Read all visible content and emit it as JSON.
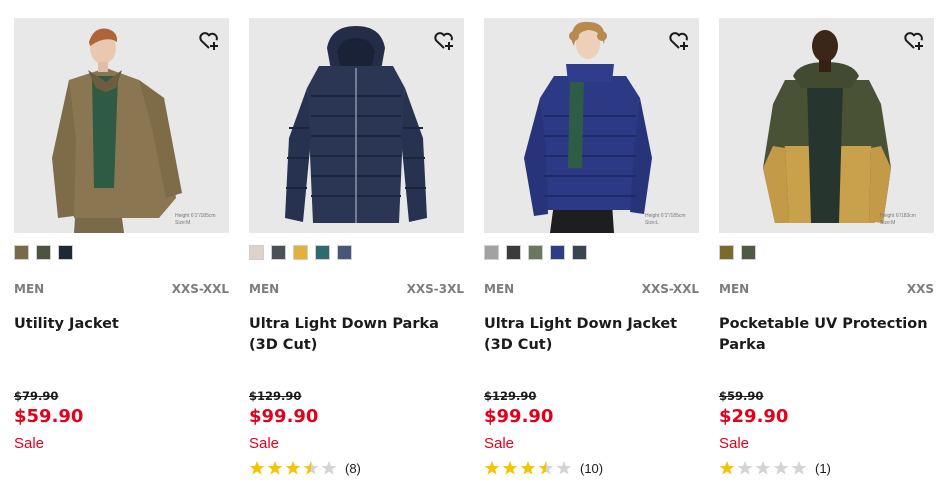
{
  "colors": {
    "sale": "#e3001b",
    "star_on": "#f5c400",
    "star_off": "#d4d4d4",
    "image_bg": "#e8e8e8"
  },
  "products": [
    {
      "gender": "MEN",
      "sizes": "XXS-XXL",
      "name": "Utility Jacket",
      "original_price": "$79.90",
      "price": "$59.90",
      "flag": "Sale",
      "model_note": "Height 6'1\"/185cm Size:M",
      "swatches": [
        "#7b6a4a",
        "#4d5540",
        "#1f2935"
      ],
      "rating": null,
      "review_count": null
    },
    {
      "gender": "MEN",
      "sizes": "XXS-3XL",
      "name": "Ultra Light Down Parka (3D Cut)",
      "original_price": "$129.90",
      "price": "$99.90",
      "flag": "Sale",
      "model_note": "",
      "swatches": [
        "#ddd3cb",
        "#4b4f57",
        "#e0b23c",
        "#2f6a6f",
        "#485677"
      ],
      "rating": 3.5,
      "review_count": "(8)"
    },
    {
      "gender": "MEN",
      "sizes": "XXS-XXL",
      "name": "Ultra Light Down Jacket (3D Cut)",
      "original_price": "$129.90",
      "price": "$99.90",
      "flag": "Sale",
      "model_note": "Height 6'1\"/185cm Size:L",
      "swatches": [
        "#a2a2a2",
        "#3b3b3d",
        "#6b7760",
        "#2c3f86",
        "#3a4452"
      ],
      "rating": 3.5,
      "review_count": "(10)"
    },
    {
      "gender": "MEN",
      "sizes": "XXS",
      "name": "Pocketable UV Protection Parka",
      "original_price": "$59.90",
      "price": "$29.90",
      "flag": "Sale",
      "model_note": "Height 6'/183cm Size:M",
      "swatches": [
        "#7a6a2d",
        "#4f5a45"
      ],
      "rating": 1,
      "review_count": "(1)"
    }
  ]
}
